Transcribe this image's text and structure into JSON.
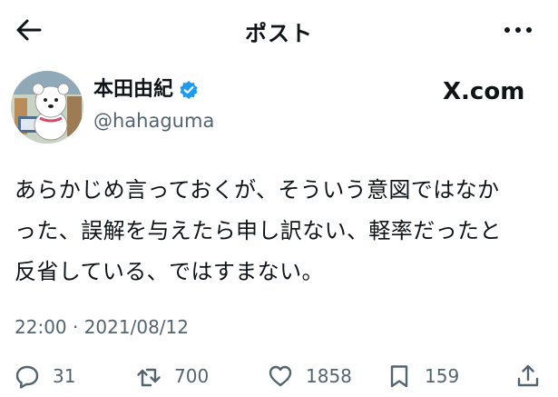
{
  "header": {
    "title": "ポスト",
    "back_icon": "arrow-left-icon",
    "more_icon": "more-horizontal-icon"
  },
  "author": {
    "display_name": "本田由紀",
    "handle": "@hahaguma",
    "verified_icon": "verified-badge-icon",
    "verified_color": "#1d9bf0",
    "avatar_icon": "bear-mascot-avatar"
  },
  "brand": {
    "label": "X.com",
    "logo_icon": "x-logo-icon"
  },
  "post": {
    "lines": [
      "あらかじめ言っておくが、そういう意図ではなか",
      "った、誤解を与えたら申し訳ない、軽率だったと",
      "反省している、ではすまない。"
    ],
    "timestamp": "22:00 · 2021/08/12"
  },
  "actions": {
    "replies": {
      "icon": "reply-icon",
      "count": "31"
    },
    "reposts": {
      "icon": "repost-icon",
      "count": "700"
    },
    "likes": {
      "icon": "heart-icon",
      "count": "1858"
    },
    "bookmarks": {
      "icon": "bookmark-icon",
      "count": "159"
    },
    "share": {
      "icon": "share-icon"
    }
  },
  "colors": {
    "text": "#0f1419",
    "secondary": "#536471",
    "accent": "#1d9bf0"
  }
}
